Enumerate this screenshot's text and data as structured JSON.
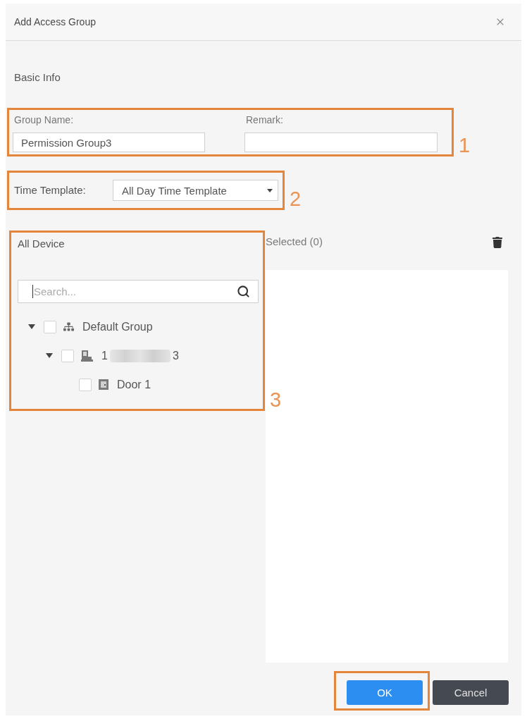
{
  "dialog": {
    "title": "Add Access Group"
  },
  "basic_info": {
    "heading": "Basic Info",
    "callout": "1",
    "fields": [
      {
        "label": "Group Name:",
        "value": "Permission Group3"
      },
      {
        "label": "Remark:"
      }
    ]
  },
  "time_template": {
    "callout": "2",
    "label": "Time Template:",
    "value": "All Day Time Template"
  },
  "all_device": {
    "callout": "3",
    "title": "All Device",
    "search": {
      "placeholder": "Search...",
      "focused": true
    },
    "tree": [
      {
        "kind": "group",
        "label": "Default Group",
        "checked": false,
        "expanded": true,
        "children": [
          {
            "kind": "device",
            "label": "1",
            "redacted": true,
            "label_end": "3",
            "checked": false,
            "expanded": true,
            "children": [
              {
                "kind": "door",
                "label": "Door 1",
                "checked": false
              }
            ]
          }
        ]
      }
    ]
  },
  "selected": {
    "title": "Selected (0)"
  },
  "buttons": [
    {
      "label": "OK",
      "kind": "primary",
      "highlighted": true
    },
    {
      "label": "Cancel",
      "kind": "secondary",
      "highlighted": false
    }
  ]
}
